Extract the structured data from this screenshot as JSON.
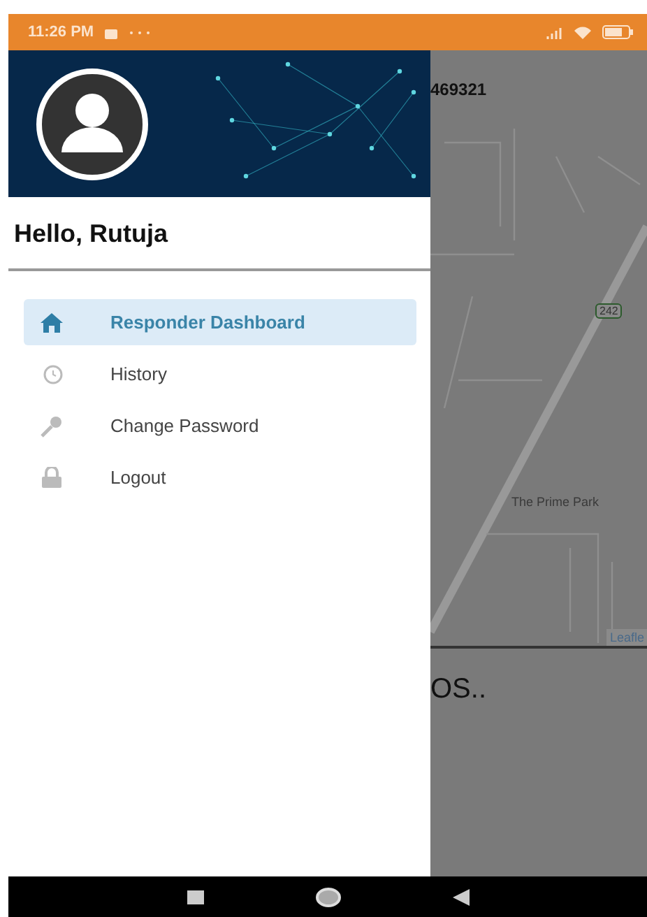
{
  "status_bar": {
    "time": "11:26 PM"
  },
  "drawer": {
    "greeting": "Hello, Rutuja",
    "items": [
      {
        "kind": "home",
        "label": "Responder Dashboard",
        "selected": true
      },
      {
        "kind": "history",
        "label": "History",
        "selected": false
      },
      {
        "kind": "key",
        "label": "Change Password",
        "selected": false
      },
      {
        "kind": "lock",
        "label": "Logout",
        "selected": false
      }
    ]
  },
  "background": {
    "header_text": "469321",
    "map": {
      "route_shield": "242",
      "place": "The Prime Park",
      "attribution": "Leafle"
    },
    "status_text": "OS.."
  }
}
